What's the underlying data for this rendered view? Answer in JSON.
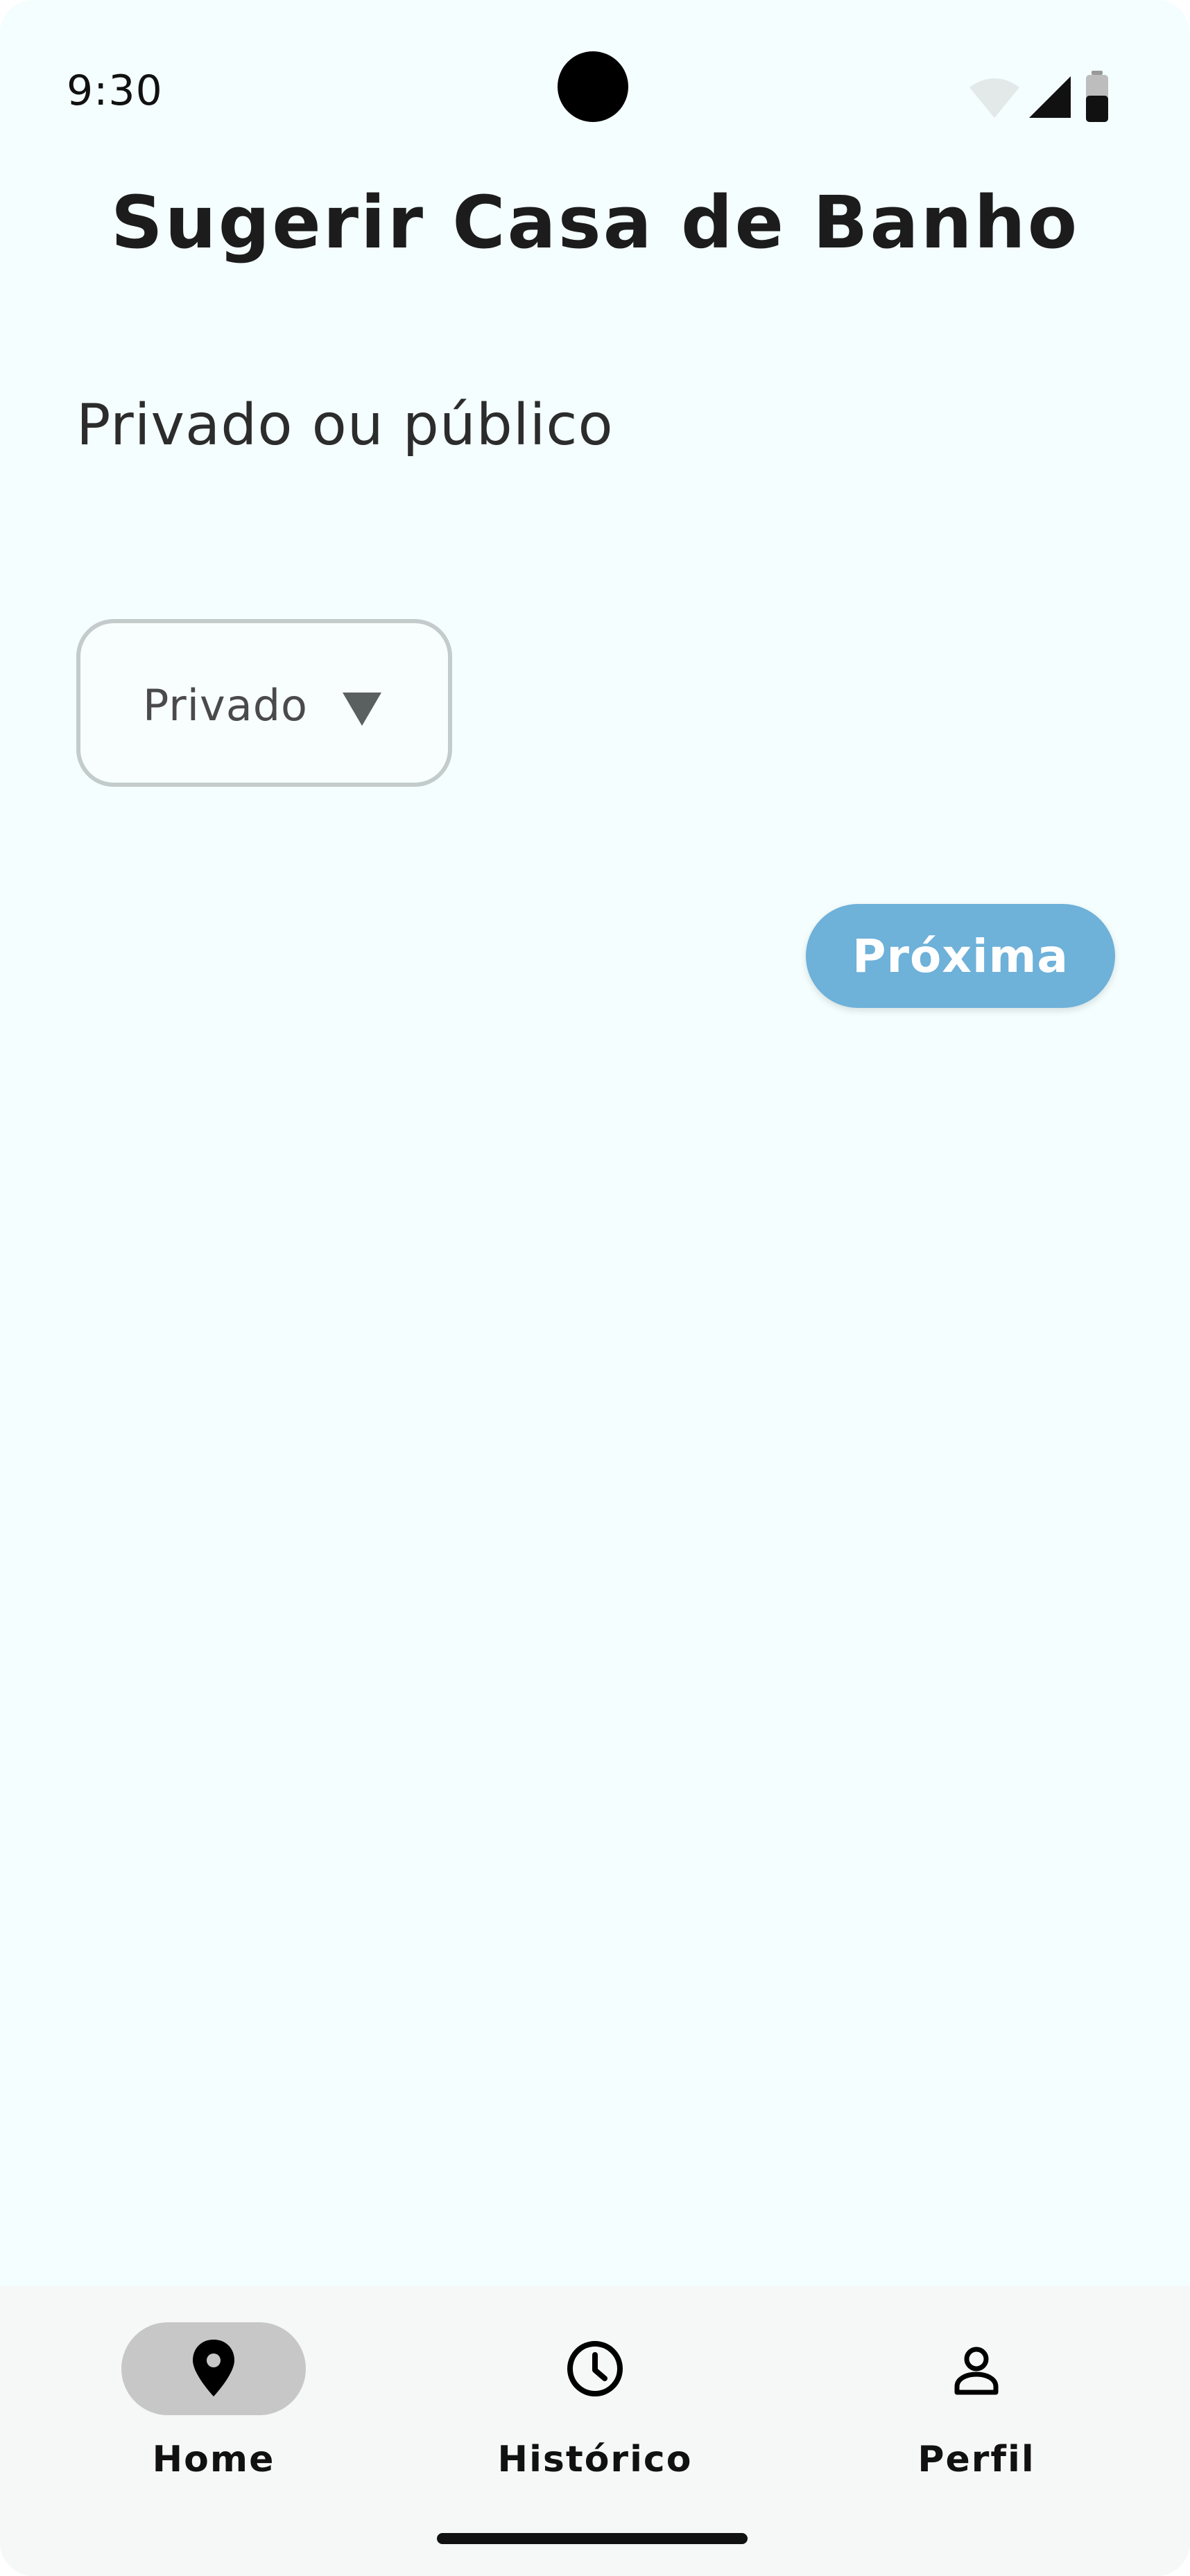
{
  "status_bar": {
    "time": "9:30",
    "icons": [
      "wifi-icon",
      "signal-icon",
      "battery-icon"
    ]
  },
  "page": {
    "title": "Sugerir Casa de Banho",
    "section_label": "Privado ou público"
  },
  "dropdown": {
    "selected_value": "Privado",
    "icon": "triangle-down-icon"
  },
  "actions": {
    "next_label": "Próxima"
  },
  "bottom_nav": {
    "items": [
      {
        "label": "Home",
        "icon": "map-pin-icon",
        "active": true
      },
      {
        "label": "Histórico",
        "icon": "clock-icon",
        "active": false
      },
      {
        "label": "Perfil",
        "icon": "person-icon",
        "active": false
      }
    ]
  },
  "colors": {
    "background": "#f4fefe",
    "accent_button": "#6eb1d9",
    "dropdown_border": "#c3cbcb",
    "nav_background": "#f6f7f7",
    "nav_active_pill": "#c7c7c7"
  }
}
